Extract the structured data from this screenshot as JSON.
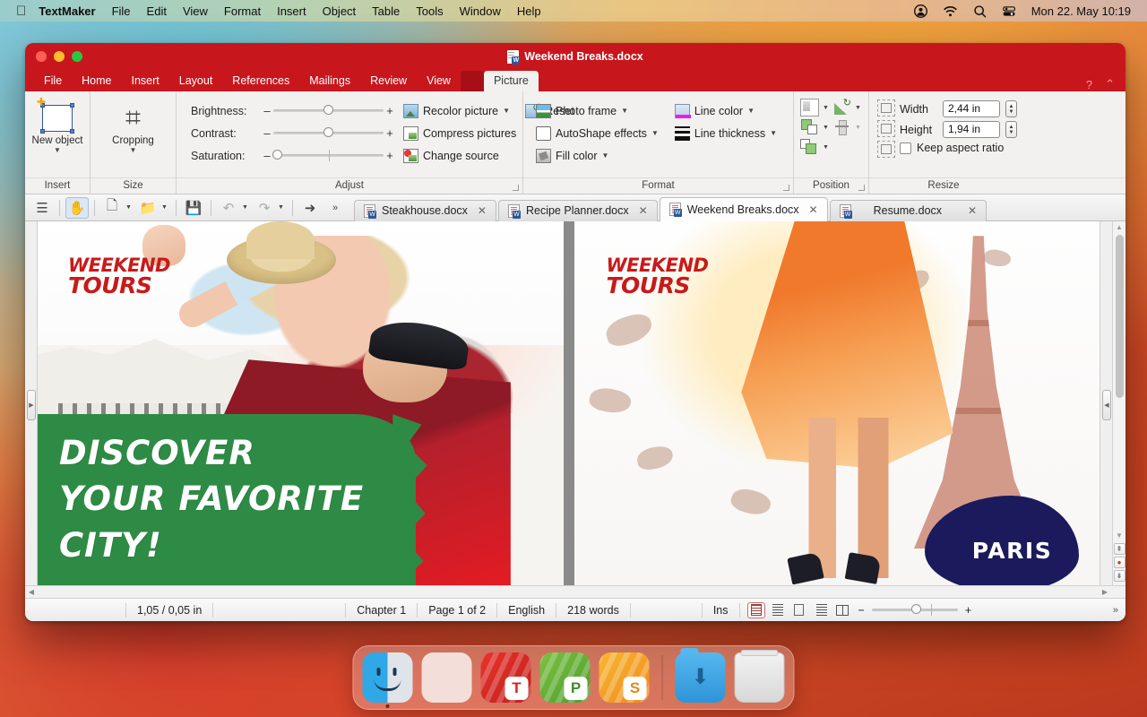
{
  "menubar": {
    "apple": "apple-logo",
    "app": "TextMaker",
    "items": [
      "File",
      "Edit",
      "View",
      "Format",
      "Insert",
      "Object",
      "Table",
      "Tools",
      "Window",
      "Help"
    ],
    "status_icons": [
      "control-center-icon",
      "wifi-icon",
      "search-icon",
      "battery-icon"
    ],
    "clock": "Mon 22. May  10:19"
  },
  "window": {
    "title": "Weekend Breaks.docx",
    "traffic_lights": [
      "close",
      "minimize",
      "maximize"
    ]
  },
  "ribbon": {
    "tabs": [
      "File",
      "Home",
      "Insert",
      "Layout",
      "References",
      "Mailings",
      "Review",
      "View"
    ],
    "contextual_tab": "Picture",
    "active_tab": "Picture",
    "corner": {
      "help": "?",
      "collapse": "⌃"
    },
    "groups": {
      "insert": {
        "label": "Insert",
        "new_object": "New object"
      },
      "size": {
        "label": "Size",
        "cropping": "Cropping"
      },
      "adjust": {
        "label": "Adjust",
        "sliders": [
          {
            "label": "Brightness:",
            "value_pct": 50
          },
          {
            "label": "Contrast:",
            "value_pct": 50
          },
          {
            "label": "Saturation:",
            "value_pct": 4
          }
        ],
        "commands": [
          "Recolor picture",
          "Compress pictures",
          "Change source",
          "Reset"
        ]
      },
      "format": {
        "label": "Format",
        "commands": [
          "Photo frame",
          "AutoShape effects",
          "Fill color",
          "Line color",
          "Line thickness"
        ]
      },
      "position": {
        "label": "Position"
      },
      "resize": {
        "label": "Resize",
        "width_label": "Width",
        "width_value": "2,44 in",
        "height_label": "Height",
        "height_value": "1,94 in",
        "keep_aspect_label": "Keep aspect ratio",
        "keep_aspect_checked": false
      }
    }
  },
  "toolbar": {
    "buttons": [
      "sidebar-icon",
      "hand-icon",
      "new-document-icon",
      "open-folder-icon",
      "save-icon",
      "undo-icon",
      "redo-icon",
      "select-icon",
      "overflow-icon"
    ]
  },
  "doctabs": [
    {
      "label": "Steakhouse.docx",
      "active": false
    },
    {
      "label": "Recipe Planner.docx",
      "active": false
    },
    {
      "label": "Weekend Breaks.docx",
      "active": true
    },
    {
      "label": "Resume.docx",
      "active": false
    }
  ],
  "document": {
    "left_page": {
      "logo_line1": "WEEKEND",
      "logo_line2": "TOURS",
      "headline": [
        "DISCOVER",
        "YOUR FAVORITE",
        "CITY!"
      ],
      "banner_color": "#2e8b45",
      "logo_color": "#c81a1a"
    },
    "right_page": {
      "logo_line1": "WEEKEND",
      "logo_line2": "TOURS",
      "city_label": "PARIS",
      "blob_color": "#1b1a5c"
    }
  },
  "statusbar": {
    "position": "1,05 / 0,05 in",
    "chapter": "Chapter 1",
    "page": "Page 1 of 2",
    "language": "English",
    "words": "218 words",
    "mode": "Ins",
    "view_buttons": [
      "normal-view-icon",
      "text-view-icon",
      "page-view-icon",
      "outline-view-icon",
      "facing-pages-icon"
    ],
    "zoom_minus": "−",
    "zoom_plus": "+",
    "overflow": "»"
  },
  "dock": {
    "items": [
      {
        "name": "finder",
        "label": "Finder",
        "running": true
      },
      {
        "name": "launchpad",
        "label": "Launchpad",
        "running": false
      },
      {
        "name": "textmaker",
        "label": "TextMaker",
        "badge": "T",
        "running": true
      },
      {
        "name": "presentations",
        "label": "Presentations",
        "badge": "P",
        "running": false
      },
      {
        "name": "planmaker",
        "label": "PlanMaker",
        "badge": "S",
        "running": false
      },
      {
        "name": "downloads-folder",
        "label": "Downloads",
        "running": false
      },
      {
        "name": "trash",
        "label": "Trash",
        "running": false
      }
    ]
  }
}
